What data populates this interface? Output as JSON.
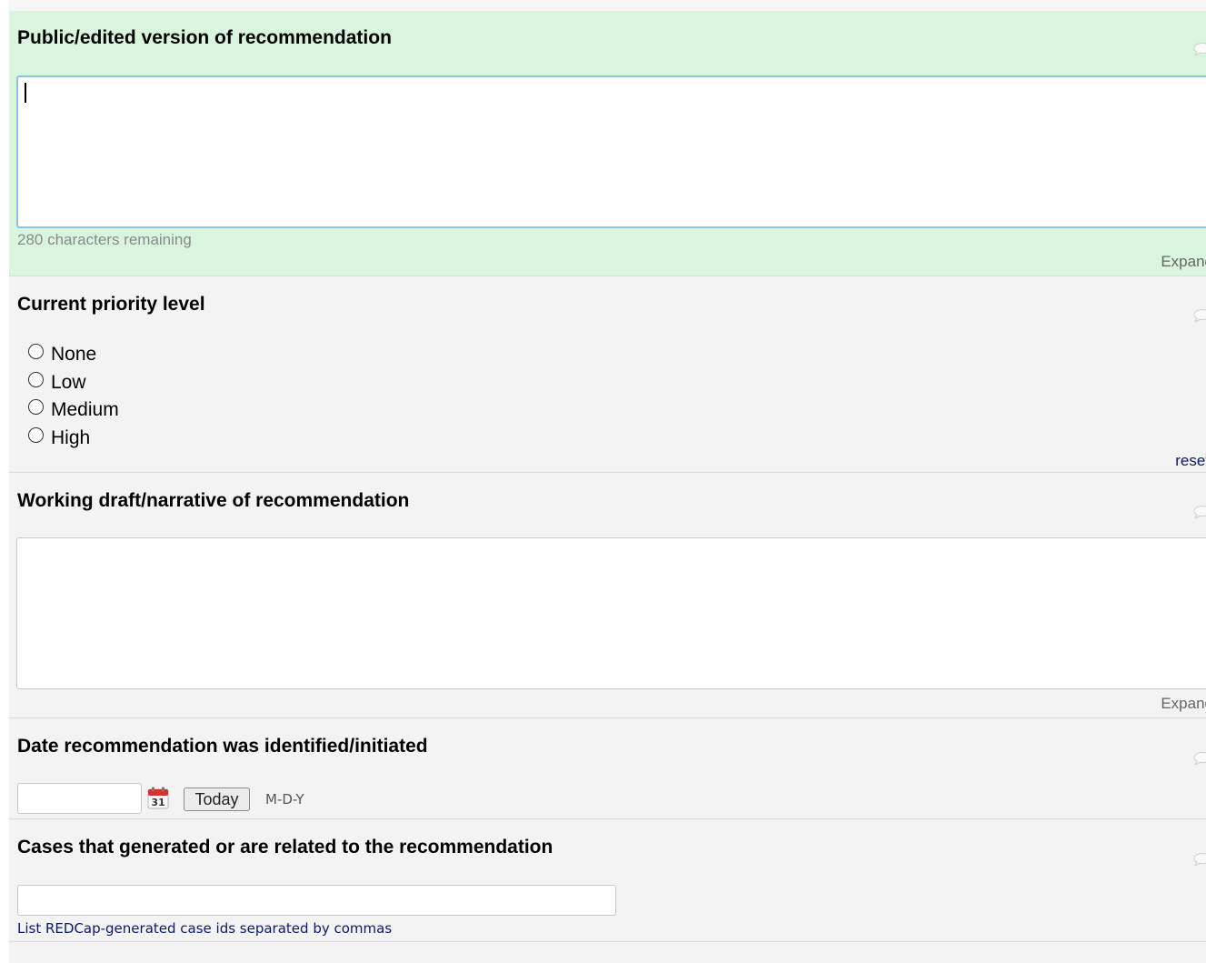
{
  "fields": {
    "public_version": {
      "label": "Public/edited version of recommendation",
      "value": "",
      "remaining_text": "280 characters remaining",
      "expand_label": "Expand"
    },
    "priority": {
      "label": "Current priority level",
      "options": [
        "None",
        "Low",
        "Medium",
        "High"
      ],
      "reset_label": "reset"
    },
    "working_draft": {
      "label": "Working draft/narrative of recommendation",
      "value": "",
      "expand_label": "Expand"
    },
    "date_identified": {
      "label": "Date recommendation was identified/initiated",
      "value": "",
      "calendar_icon_text": "31",
      "today_label": "Today",
      "format_hint": "M-D-Y"
    },
    "related_cases": {
      "label": "Cases that generated or are related to the recommendation",
      "value": "",
      "note": "List REDCap-generated case ids separated by commas"
    }
  },
  "icons": {
    "comment": "comment-bubble-icon",
    "calendar": "calendar-icon"
  },
  "colors": {
    "active_row_bg": "#d9f5dd",
    "row_bg": "#f3f3f3",
    "focus_border": "#8ec2ea",
    "link_blue": "#0a1a6b"
  }
}
